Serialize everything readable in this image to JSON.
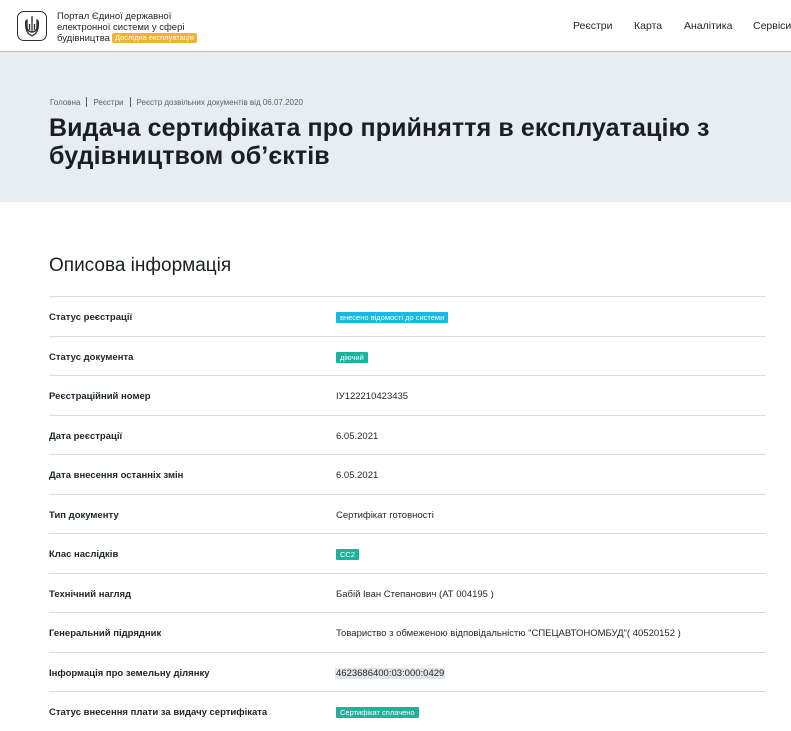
{
  "header": {
    "portal_title": "Портал Єдиної державної електронної системи у сфері будівництва",
    "beta_badge": "Дослідна експлуатація",
    "nav": [
      "Реєстри",
      "Карта",
      "Аналітика",
      "Сервіси"
    ]
  },
  "breadcrumb": [
    "Головна",
    "Реєстри",
    "Реєстр дозвільних документів від 06.07.2020"
  ],
  "page_title": "Видача сертифіката про прийняття в експлуатацію з\nбудівництвом об’єктів",
  "section_title": "Описова інформація",
  "rows": [
    {
      "label": "Статус реєстрації",
      "value": "внесено відомості до системи",
      "type": "badge",
      "color": "#1bb8e3"
    },
    {
      "label": "Статус документа",
      "value": "діючий",
      "type": "badge",
      "color": "#1bb39a"
    },
    {
      "label": "Реєстраційний номер",
      "value": "ІУ122210423435",
      "type": "text"
    },
    {
      "label": "Дата реєстрації",
      "value": "6.05.2021",
      "type": "text"
    },
    {
      "label": "Дата внесення останніх змін",
      "value": "6.05.2021",
      "type": "text"
    },
    {
      "label": "Тип документу",
      "value": "Сертифікат готовності",
      "type": "text"
    },
    {
      "label": "Клас наслідків",
      "value": "СС2",
      "type": "badge",
      "color": "#1bb39a"
    },
    {
      "label": "Технічний нагляд",
      "value": "Бабій Іван Степанович (АТ 004195 )",
      "type": "text"
    },
    {
      "label": "Генеральний підрядник",
      "value": "Товариство з обмеженою відповідальністю \"СПЕЦАВТОНОМБУД\"( 40520152 )",
      "type": "text"
    },
    {
      "label": "Інформація про земельну ділянку",
      "value": "4623686400:03:000:0429",
      "type": "highlight"
    },
    {
      "label": "Статус внесення плати за видачу сертифіката",
      "value": "Сертифікат сплачено",
      "type": "badge",
      "color": "#1bb39a"
    }
  ]
}
